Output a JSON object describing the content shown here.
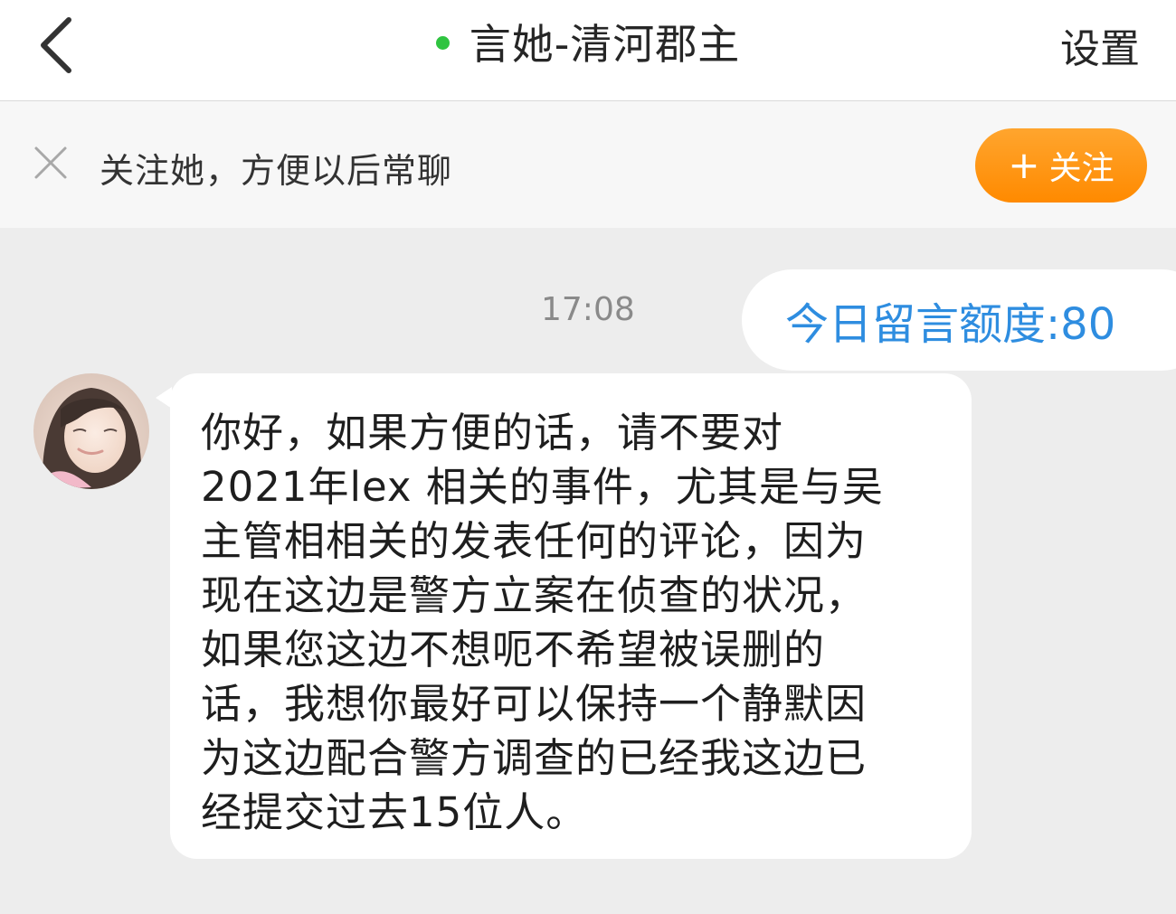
{
  "header": {
    "title": "言她-清河郡主",
    "settings_label": "设置",
    "online_color": "#2fc440"
  },
  "follow_banner": {
    "text": "关注她，方便以后常聊",
    "button_label": "关注",
    "button_plus": "+",
    "button_color": "#ff9500"
  },
  "chat": {
    "timestamp": "17:08",
    "quota_text": "今日留言额度:80",
    "message_lines": [
      "你好，如果方便的话，请不要对",
      "2021年lex 相关的事件，尤其是与吴",
      "主管相相关的发表任何的评论，因为",
      "现在这边是警方立案在侦查的状况，",
      "如果您这边不想呃不希望被误删的",
      "话，我想你最好可以保持一个静默因",
      "为这边配合警方调查的已经我这边已",
      "经提交过去15位人。"
    ]
  },
  "icons": {
    "back": "chevron-left-icon",
    "close": "close-icon"
  }
}
